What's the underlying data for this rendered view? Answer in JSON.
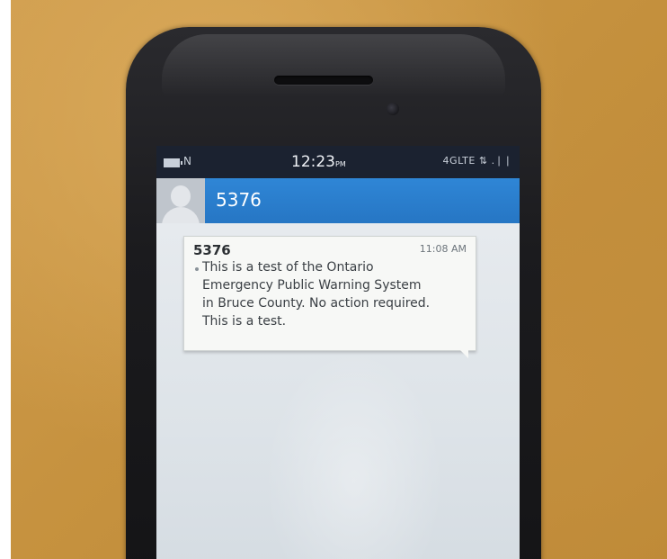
{
  "status_bar": {
    "notification_indicator": "N",
    "time": "12:23",
    "time_suffix": "PM",
    "network": "4GLTE ⇅ .❘❘"
  },
  "conversation": {
    "contact_name": "5376"
  },
  "message": {
    "sender": "5376",
    "time": "11:08 AM",
    "lines": [
      "This is a test of the Ontario",
      "Emergency Public Warning System",
      "in Bruce County. No action required.",
      "This is a test."
    ]
  },
  "colors": {
    "contact_bar": "#2a7ecd",
    "status_bar": "#1b2230",
    "phone_body": "#1b1b1e",
    "table": "#c6923f"
  },
  "icons": {
    "battery": "battery-icon",
    "avatar": "contact-avatar-icon",
    "signal": "signal-icon"
  }
}
